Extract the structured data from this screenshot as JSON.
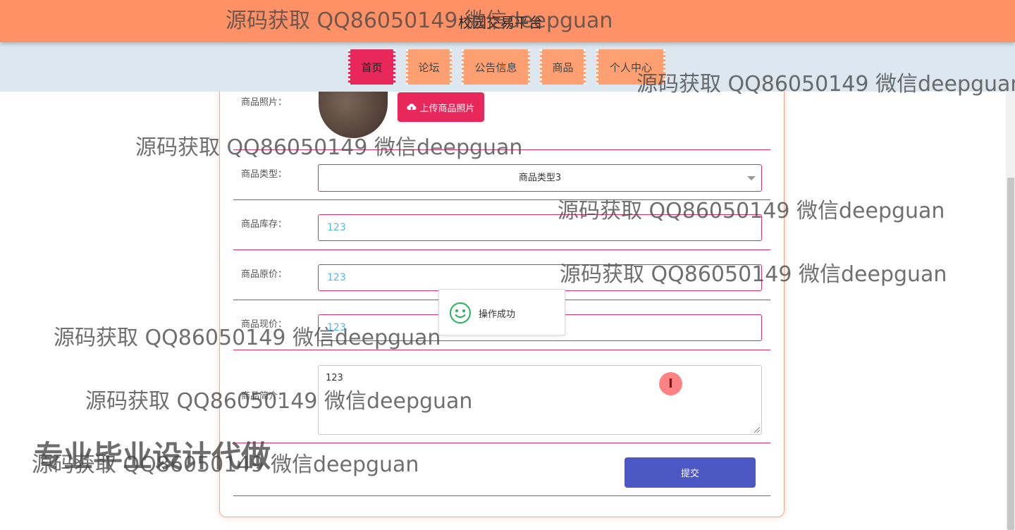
{
  "header": {
    "title": "校园交易平台",
    "bg_color": "#ff9166"
  },
  "nav": {
    "items": [
      {
        "label": "首页",
        "active": true
      },
      {
        "label": "论坛",
        "active": false
      },
      {
        "label": "公告信息",
        "active": false
      },
      {
        "label": "商品",
        "active": false
      },
      {
        "label": "个人中心",
        "active": false
      }
    ],
    "active_color": "#e8275b",
    "item_color": "#ffa073"
  },
  "form": {
    "photo": {
      "label": "商品照片：",
      "upload_button": "上传商品照片",
      "upload_icon": "cloud-upload-icon"
    },
    "type": {
      "label": "商品类型：",
      "value": "商品类型3"
    },
    "stock": {
      "label": "商品库存：",
      "value": "123"
    },
    "original_price": {
      "label": "商品原价：",
      "value": "123"
    },
    "current_price": {
      "label": "商品现价：",
      "value": "123"
    },
    "intro": {
      "label": "商品简介：",
      "value": "123"
    },
    "submit_label": "提交",
    "submit_color": "#4c57c3",
    "accent_color": "#d7306a"
  },
  "toast": {
    "icon": "smile-icon",
    "message": "操作成功"
  },
  "cursor": {
    "icon": "text-cursor-icon",
    "glyph": "I"
  },
  "watermarks": {
    "items": [
      "源码获取 QQ86050149 微信deepguan",
      "源码获取 QQ86050149 微信deepguan",
      "源码获取 QQ86050149 微信deepguan",
      "源码获取 QQ86050149 微信deepguan",
      "源码获取 QQ86050149 微信deepguan",
      "源码获取 QQ86050149 微信deepguan",
      "源码获取 QQ86050149 微信deepguan",
      "源码获取 QQ86050149 微信deepguan"
    ],
    "big": "专业毕业设计代做"
  }
}
